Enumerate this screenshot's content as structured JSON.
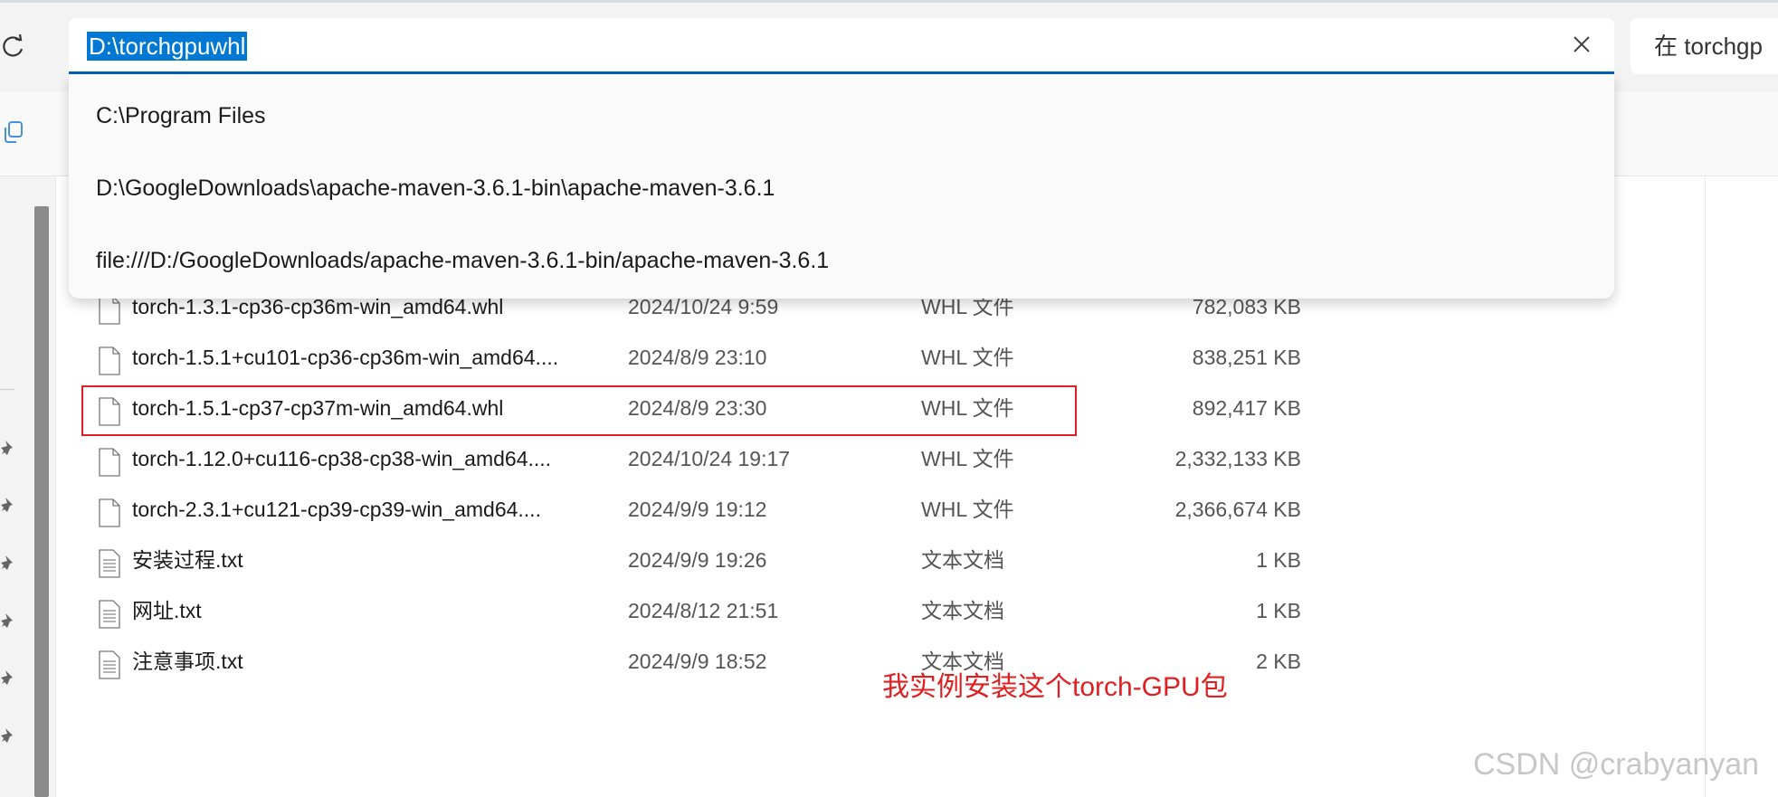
{
  "address_bar": {
    "path": "D:\\torchgpuwhl",
    "suggestions": [
      "C:\\Program Files",
      "D:\\GoogleDownloads\\apache-maven-3.6.1-bin\\apache-maven-3.6.1",
      "file:///D:/GoogleDownloads/apache-maven-3.6.1-bin/apache-maven-3.6.1"
    ]
  },
  "search": {
    "text": "在 torchgp"
  },
  "files": [
    {
      "name": "torch-1.3.1-cp36-cp36m-win_amd64.whl",
      "date": "2024/10/24 9:59",
      "type": "WHL 文件",
      "size": "782,083 KB",
      "icon": "file-icon"
    },
    {
      "name": "torch-1.5.1+cu101-cp36-cp36m-win_amd64....",
      "date": "2024/8/9 23:10",
      "type": "WHL 文件",
      "size": "838,251 KB",
      "icon": "file-icon"
    },
    {
      "name": "torch-1.5.1-cp37-cp37m-win_amd64.whl",
      "date": "2024/8/9 23:30",
      "type": "WHL 文件",
      "size": "892,417 KB",
      "icon": "file-icon"
    },
    {
      "name": "torch-1.12.0+cu116-cp38-cp38-win_amd64....",
      "date": "2024/10/24 19:17",
      "type": "WHL 文件",
      "size": "2,332,133 KB",
      "icon": "file-icon"
    },
    {
      "name": "torch-2.3.1+cu121-cp39-cp39-win_amd64....",
      "date": "2024/9/9 19:12",
      "type": "WHL 文件",
      "size": "2,366,674 KB",
      "icon": "file-icon"
    },
    {
      "name": "安装过程.txt",
      "date": "2024/9/9 19:26",
      "type": "文本文档",
      "size": "1 KB",
      "icon": "text-file-icon"
    },
    {
      "name": "网址.txt",
      "date": "2024/8/12 21:51",
      "type": "文本文档",
      "size": "1 KB",
      "icon": "text-file-icon"
    },
    {
      "name": "注意事项.txt",
      "date": "2024/9/9 18:52",
      "type": "文本文档",
      "size": "2 KB",
      "icon": "text-file-icon"
    }
  ],
  "annotation": "我实例安装这个torch-GPU包",
  "watermark": "CSDN @crabyanyan",
  "colors": {
    "accent": "#0078d4",
    "highlight_red": "#e02020"
  }
}
